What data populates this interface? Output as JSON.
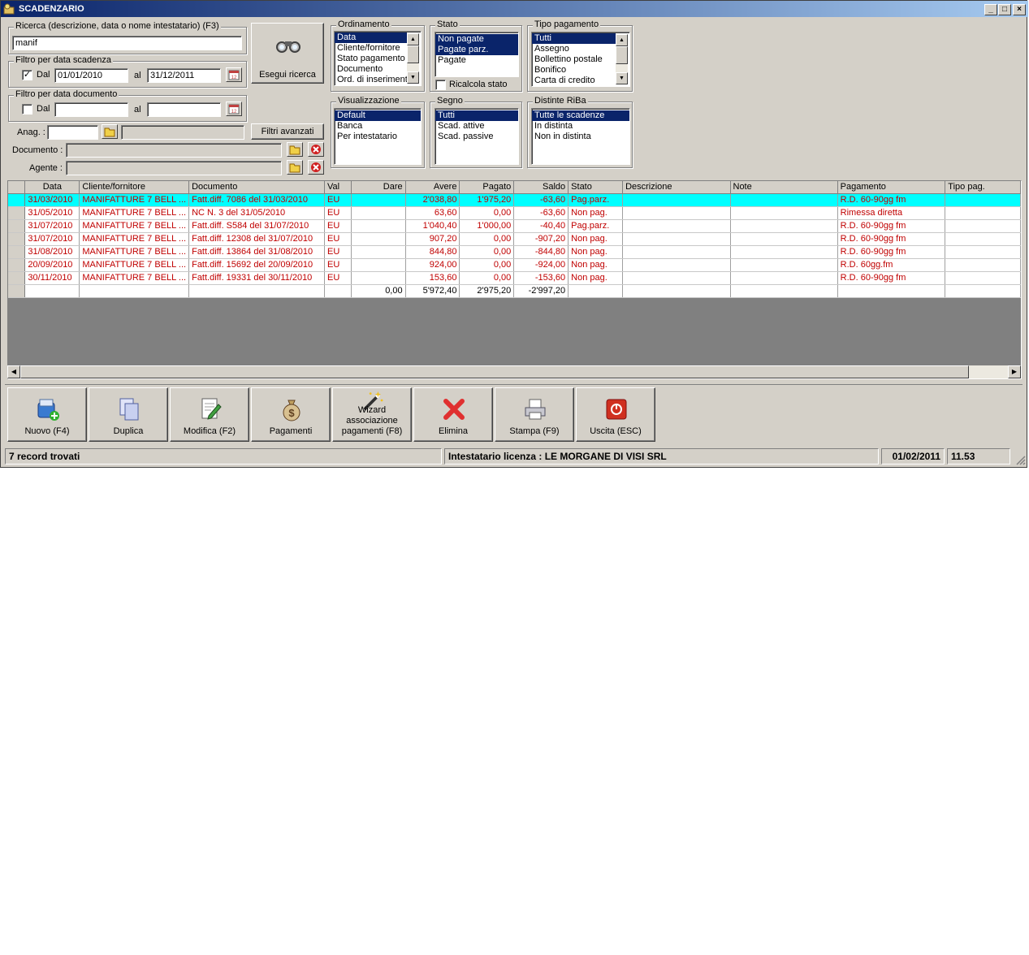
{
  "window": {
    "title": "SCADENZARIO",
    "min": "_",
    "max": "□",
    "close": "×"
  },
  "search": {
    "group_label": "Ricerca (descrizione, data o nome intestatario) (F3)",
    "value": "manif",
    "run_label": "Esegui ricerca"
  },
  "filter_due": {
    "group_label": "Filtro per data scadenza",
    "checked": "✓",
    "from_label": "Dal",
    "from": "01/01/2010",
    "to_label": "al",
    "to": "31/12/2011"
  },
  "filter_doc": {
    "group_label": "Filtro per data documento",
    "from_label": "Dal",
    "from": "",
    "to_label": "al",
    "to": ""
  },
  "anag": {
    "label": "Anag. :",
    "code": "",
    "name": "",
    "advanced_label": "Filtri avanzati"
  },
  "documento": {
    "label": "Documento :",
    "value": ""
  },
  "agente": {
    "label": "Agente :",
    "value": ""
  },
  "ordinamento": {
    "label": "Ordinamento",
    "items": [
      "Data",
      "Cliente/fornitore",
      "Stato pagamento",
      "Documento",
      "Ord. di inserimento"
    ]
  },
  "stato": {
    "label": "Stato",
    "items": [
      "Non pagate",
      "Pagate parz.",
      "Pagate"
    ],
    "recalc_label": "Ricalcola stato"
  },
  "tipo_pagamento": {
    "label": "Tipo pagamento",
    "items": [
      "Tutti",
      "Assegno",
      "Bollettino postale",
      "Bonifico",
      "Carta di credito"
    ]
  },
  "visualizzazione": {
    "label": "Visualizzazione",
    "items": [
      "Default",
      "Banca",
      "Per intestatario"
    ]
  },
  "segno": {
    "label": "Segno",
    "items": [
      "Tutti",
      "Scad. attive",
      "Scad. passive"
    ]
  },
  "distinte": {
    "label": "Distinte RiBa",
    "items": [
      "Tutte le scadenze",
      "In distinta",
      "Non in distinta"
    ]
  },
  "grid": {
    "columns": [
      "Data",
      "Cliente/fornitore",
      "Documento",
      "Val",
      "Dare",
      "Avere",
      "Pagato",
      "Saldo",
      "Stato",
      "Descrizione",
      "Note",
      "Pagamento",
      "Tipo pag."
    ],
    "rows": [
      [
        "31/03/2010",
        "MANIFATTURE 7 BELL ...",
        "Fatt.diff. 7086 del 31/03/2010",
        "EU",
        "",
        "2'038,80",
        "1'975,20",
        "-63,60",
        "Pag.parz.",
        "",
        "",
        "R.D. 60-90gg fm",
        ""
      ],
      [
        "31/05/2010",
        "MANIFATTURE 7 BELL ...",
        "NC N. 3 del 31/05/2010",
        "EU",
        "",
        "63,60",
        "0,00",
        "-63,60",
        "Non pag.",
        "",
        "",
        "Rimessa diretta",
        ""
      ],
      [
        "31/07/2010",
        "MANIFATTURE 7 BELL ...",
        "Fatt.diff. S584 del 31/07/2010",
        "EU",
        "",
        "1'040,40",
        "1'000,00",
        "-40,40",
        "Pag.parz.",
        "",
        "",
        "R.D. 60-90gg fm",
        ""
      ],
      [
        "31/07/2010",
        "MANIFATTURE 7 BELL ...",
        "Fatt.diff. 12308 del 31/07/2010",
        "EU",
        "",
        "907,20",
        "0,00",
        "-907,20",
        "Non pag.",
        "",
        "",
        "R.D. 60-90gg fm",
        ""
      ],
      [
        "31/08/2010",
        "MANIFATTURE 7 BELL ...",
        "Fatt.diff. 13864 del 31/08/2010",
        "EU",
        "",
        "844,80",
        "0,00",
        "-844,80",
        "Non pag.",
        "",
        "",
        "R.D. 60-90gg fm",
        ""
      ],
      [
        "20/09/2010",
        "MANIFATTURE 7 BELL ...",
        "Fatt.diff. 15692 del 20/09/2010",
        "EU",
        "",
        "924,00",
        "0,00",
        "-924,00",
        "Non pag.",
        "",
        "",
        "R.D. 60gg.fm",
        ""
      ],
      [
        "30/11/2010",
        "MANIFATTURE 7 BELL ...",
        "Fatt.diff. 19331 del 30/11/2010",
        "EU",
        "",
        "153,60",
        "0,00",
        "-153,60",
        "Non pag.",
        "",
        "",
        "R.D. 60-90gg fm",
        ""
      ]
    ],
    "totals": [
      "",
      "",
      "",
      "",
      "0,00",
      "5'972,40",
      "2'975,20",
      "-2'997,20",
      "",
      "",
      "",
      "",
      ""
    ]
  },
  "toolbar": [
    "Nuovo (F4)",
    "Duplica",
    "Modifica (F2)",
    "Pagamenti",
    "Wizard\nassociazione\npagamenti (F8)",
    "Elimina",
    "Stampa (F9)",
    "Uscita (ESC)"
  ],
  "status": {
    "records": "7 record trovati",
    "license": "Intestatario licenza : LE MORGANE DI VISI SRL",
    "date": "01/02/2011",
    "time": "11.53"
  }
}
